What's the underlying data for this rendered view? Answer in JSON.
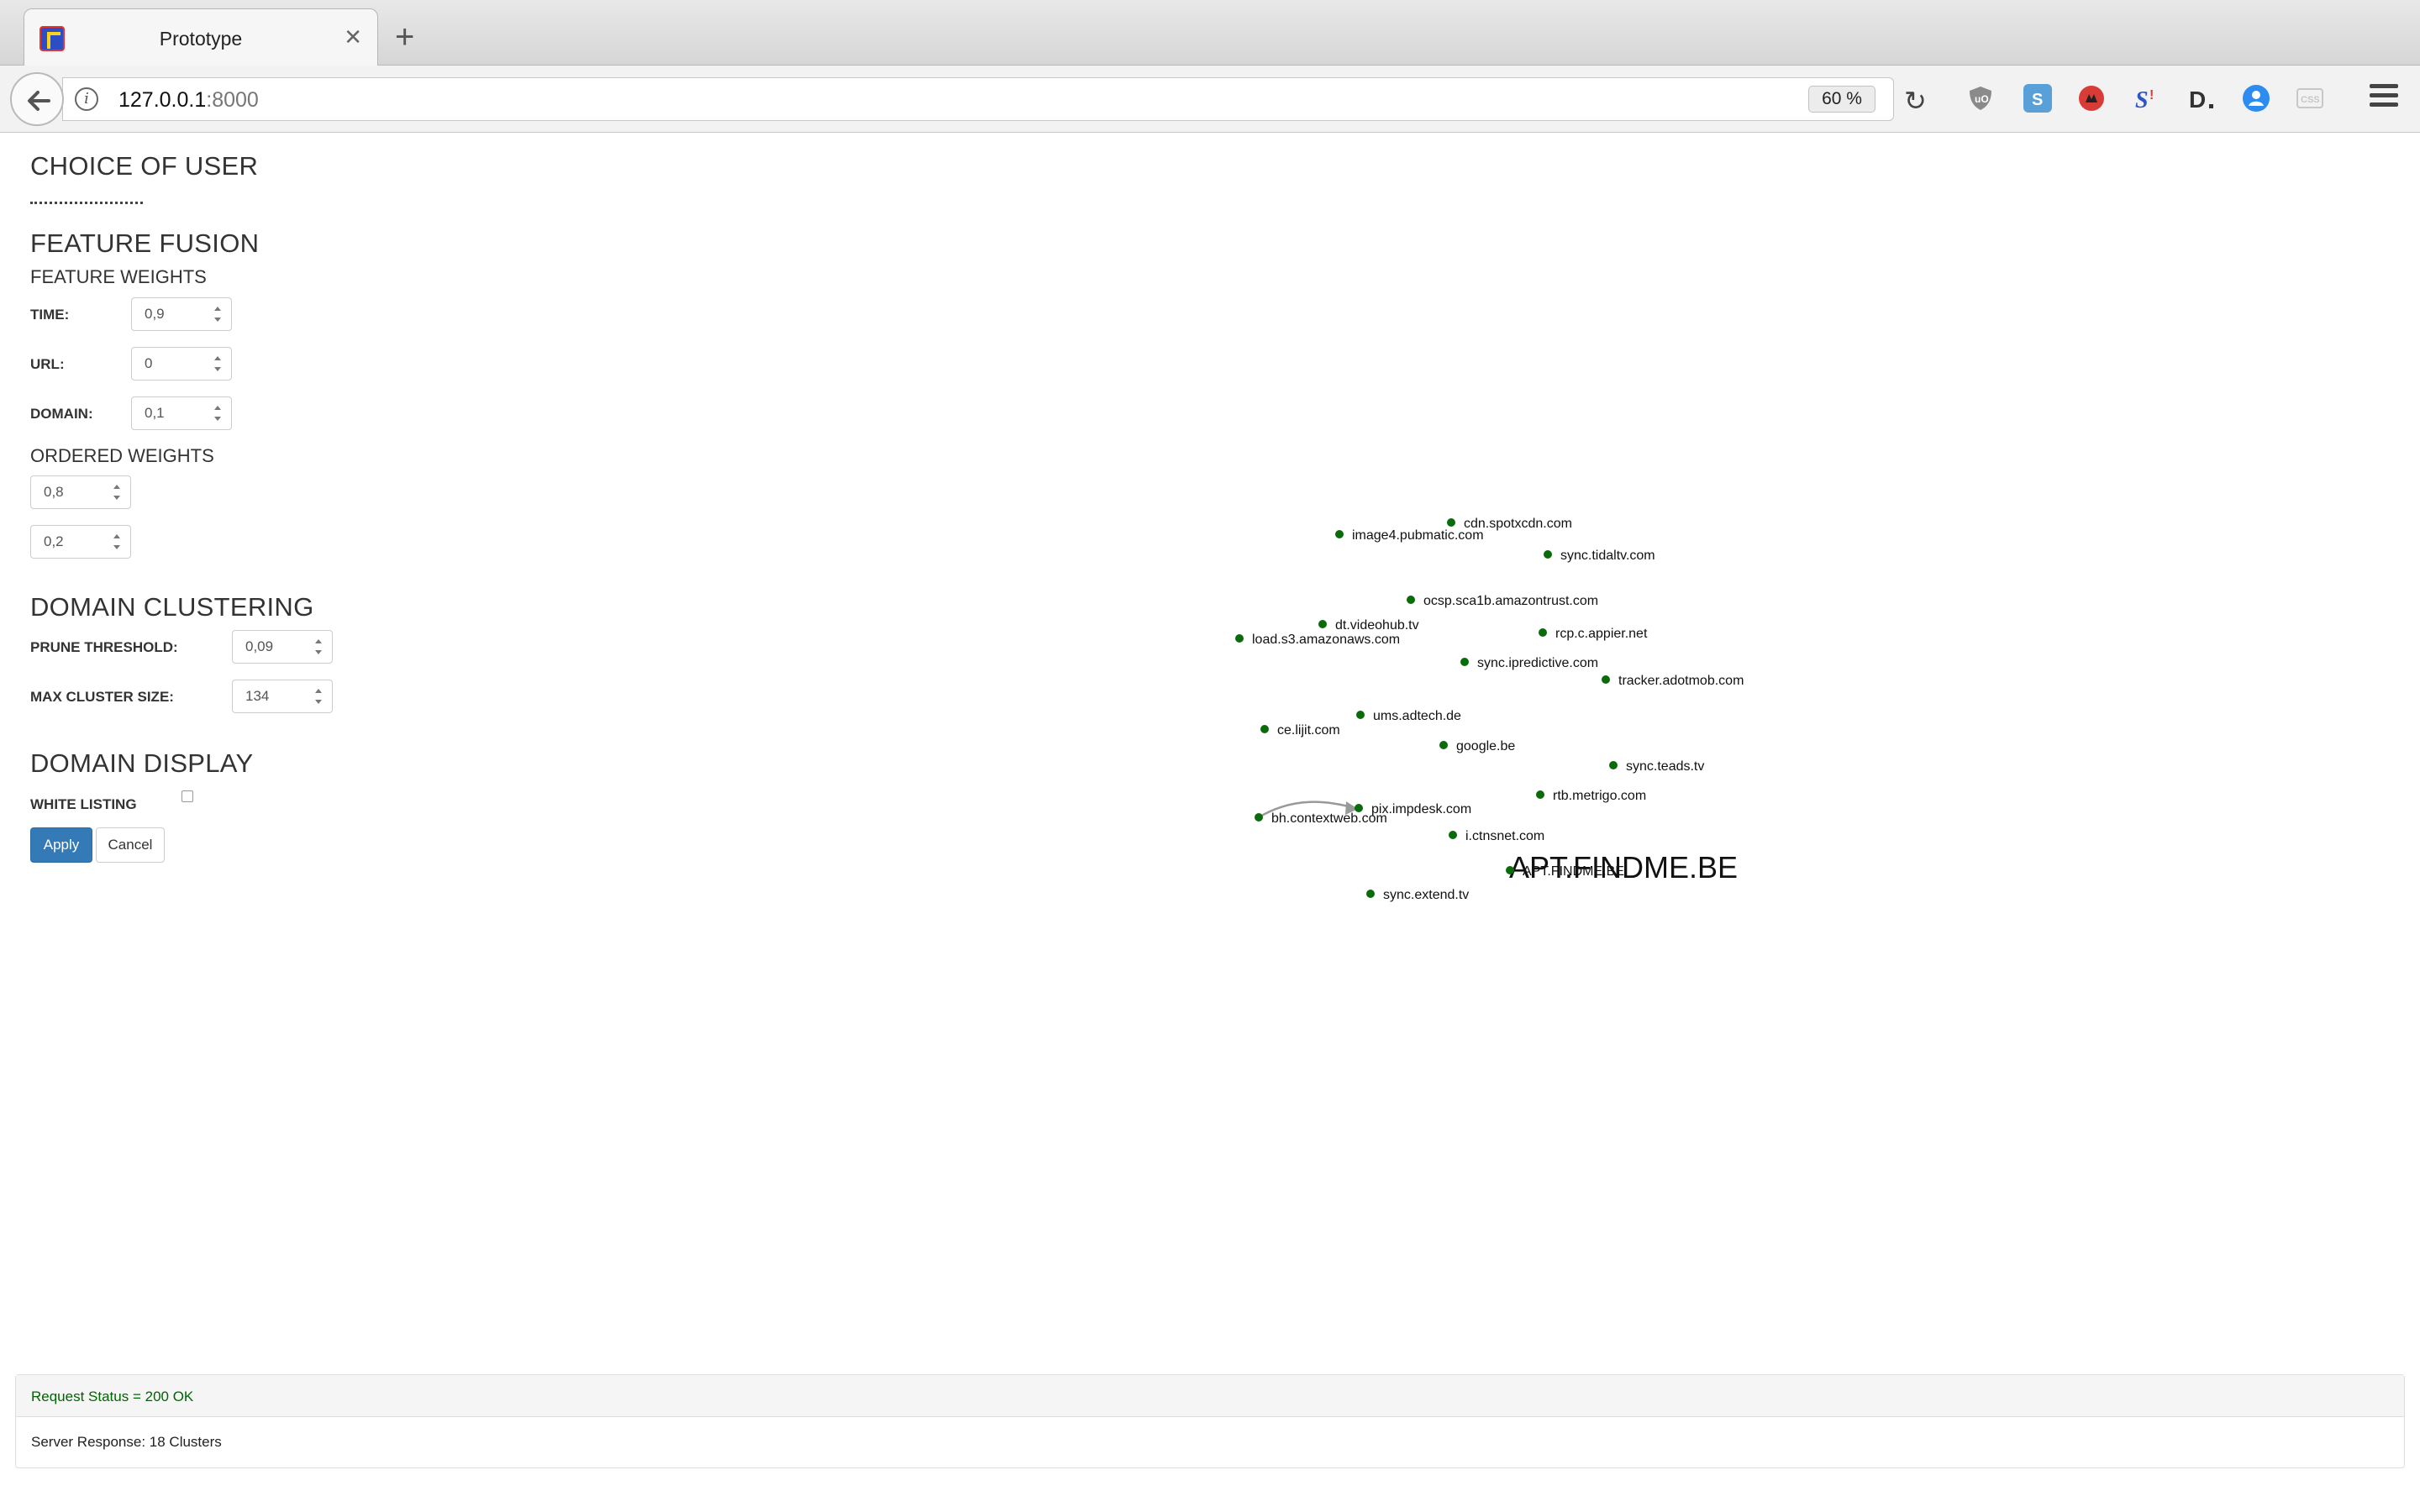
{
  "browser": {
    "tab_title": "Prototype",
    "url_host": "127.0.0.1",
    "url_port": ":8000",
    "zoom": "60 %",
    "extension_colors": [
      "#8a8a8a",
      "#5aa0d8",
      "#d93b36",
      "#2f55c4",
      "#333333",
      "#2d8cf0",
      "#c7c7c7"
    ]
  },
  "sidebar": {
    "choice_of_user_title": "CHOICE OF USER",
    "feature_fusion_title": "FEATURE FUSION",
    "feature_weights_title": "FEATURE WEIGHTS",
    "time_label": "TIME:",
    "time_value": "0,9",
    "url_label": "URL:",
    "url_value": "0",
    "domain_label": "DOMAIN:",
    "domain_value": "0,1",
    "ordered_weights_title": "ORDERED WEIGHTS",
    "ordered_weight_1": "0,8",
    "ordered_weight_2": "0,2",
    "domain_clustering_title": "DOMAIN CLUSTERING",
    "prune_threshold_label": "PRUNE THRESHOLD:",
    "prune_threshold_value": "0,09",
    "max_cluster_size_label": "MAX CLUSTER SIZE:",
    "max_cluster_size_value": "134",
    "domain_display_title": "DOMAIN DISPLAY",
    "white_listing_label": "WHITE LISTING",
    "white_listing_checked": false,
    "apply_label": "Apply",
    "cancel_label": "Cancel"
  },
  "graph": {
    "cluster_title": "APT.FINDME.BE",
    "node_color": "#0a6b0a",
    "edge": {
      "from": "bh.contextweb.com",
      "to": "pix.impdesk.com"
    },
    "nodes": [
      "cdn.spotxcdn.com",
      "image4.pubmatic.com",
      "sync.tidaltv.com",
      "ocsp.sca1b.amazontrust.com",
      "dt.videohub.tv",
      "load.s3.amazonaws.com",
      "rcp.c.appier.net",
      "sync.ipredictive.com",
      "tracker.adotmob.com",
      "ums.adtech.de",
      "ce.lijit.com",
      "google.be",
      "sync.teads.tv",
      "rtb.metrigo.com",
      "pix.impdesk.com",
      "bh.contextweb.com",
      "i.ctnsnet.com",
      "APT.FINDME.BE",
      "sync.extend.tv"
    ]
  },
  "status": {
    "request_status": "Request Status = 200 OK",
    "server_response": "Server Response: 18 Clusters"
  }
}
